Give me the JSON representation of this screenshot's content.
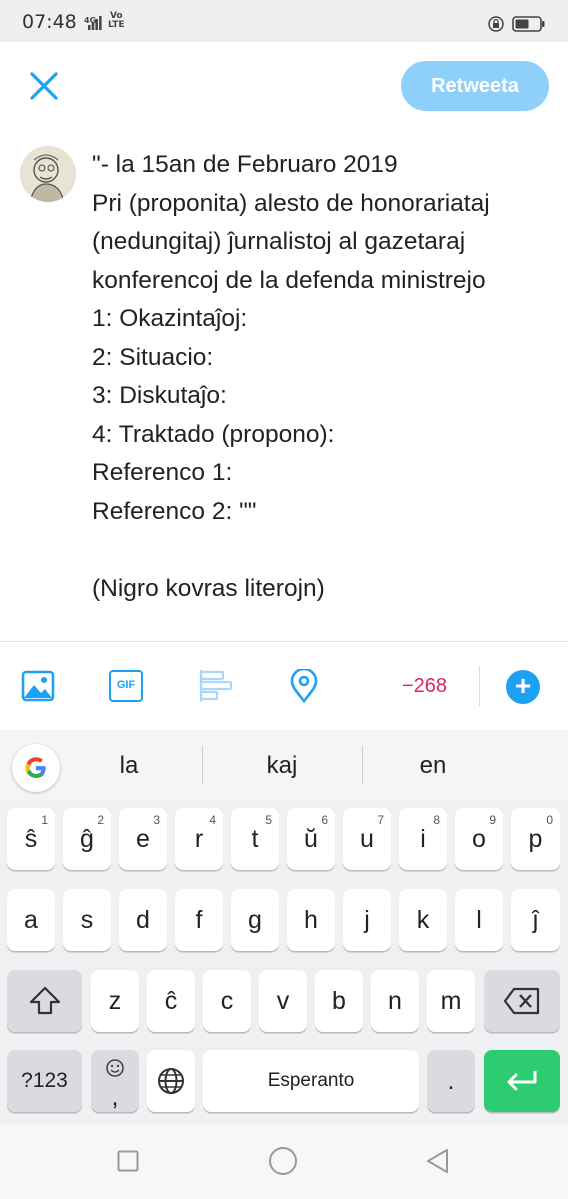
{
  "status_bar": {
    "time": "07:48",
    "network": "4G",
    "volte_line1": "Vo",
    "volte_line2": "LTE"
  },
  "header": {
    "close_icon": "close-icon",
    "retweet_label": "Retweeta"
  },
  "tweet": {
    "text": "\"- la 15an de Februaro 2019\nPri (proponita) alesto de honorariataj (nedungitaj) ĵurnalistoj al gazetaraj konferencoj de la defenda ministrejo\n1: Okazintaĵoj:\n2: Situacio:\n3: Diskutaĵo:\n4: Traktado (propono):\nReferenco 1:\nReferenco 2: \"\"\n\n(Nigro kovras literojn)"
  },
  "toolbar": {
    "icons": [
      "image-icon",
      "gif-icon",
      "poll-icon",
      "location-icon"
    ],
    "gif_label": "GIF",
    "char_count": "−268",
    "add_label": "+"
  },
  "keyboard": {
    "suggestions": [
      "la",
      "kaj",
      "en"
    ],
    "row1": [
      {
        "label": "ŝ",
        "hint": "1"
      },
      {
        "label": "ĝ",
        "hint": "2"
      },
      {
        "label": "e",
        "hint": "3"
      },
      {
        "label": "r",
        "hint": "4"
      },
      {
        "label": "t",
        "hint": "5"
      },
      {
        "label": "ŭ",
        "hint": "6"
      },
      {
        "label": "u",
        "hint": "7"
      },
      {
        "label": "i",
        "hint": "8"
      },
      {
        "label": "o",
        "hint": "9"
      },
      {
        "label": "p",
        "hint": "0"
      }
    ],
    "row2": [
      "a",
      "s",
      "d",
      "f",
      "g",
      "h",
      "j",
      "k",
      "l",
      "ĵ"
    ],
    "row3": [
      "z",
      "ĉ",
      "c",
      "v",
      "b",
      "n",
      "m"
    ],
    "symbols_label": "?123",
    "emoji_comma_label": ",",
    "space_label": "Esperanto",
    "period_label": "."
  },
  "colors": {
    "accent": "#1da1f2",
    "retweet_disabled": "#8ed0f9",
    "counter": "#e0245e",
    "enter": "#2ecc71"
  }
}
